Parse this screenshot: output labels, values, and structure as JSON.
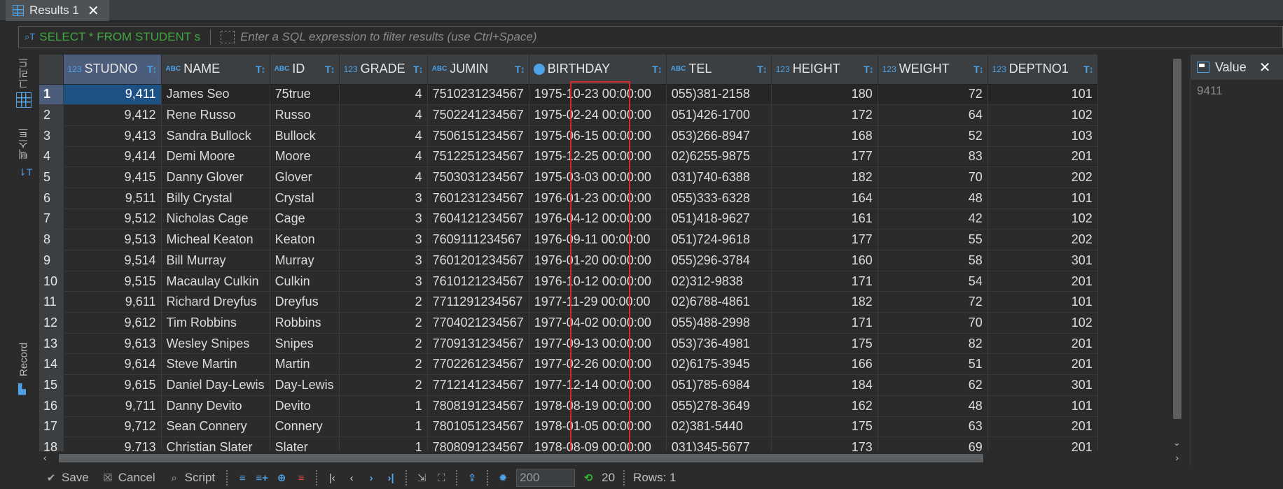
{
  "tab": {
    "label": "Results 1",
    "close": "✕"
  },
  "filter": {
    "sql": "SELECT * FROM STUDENT s",
    "placeholder": "Enter a SQL expression to filter results (use Ctrl+Space)"
  },
  "leftstrip": {
    "grid_label": "그리드",
    "text_label": "텍스트",
    "record_label": "Record"
  },
  "columns": [
    {
      "type": "123",
      "name": "STUDNO"
    },
    {
      "type": "ABC",
      "name": "NAME"
    },
    {
      "type": "ABC",
      "name": "ID"
    },
    {
      "type": "123",
      "name": "GRADE"
    },
    {
      "type": "ABC",
      "name": "JUMIN"
    },
    {
      "type": "date",
      "name": "BIRTHDAY"
    },
    {
      "type": "ABC",
      "name": "TEL"
    },
    {
      "type": "123",
      "name": "HEIGHT"
    },
    {
      "type": "123",
      "name": "WEIGHT"
    },
    {
      "type": "123",
      "name": "DEPTNO1"
    }
  ],
  "rows": [
    [
      "1",
      "9,411",
      "James Seo",
      "75true",
      "4",
      "7510231234567",
      "1975-10-23 00:00:00",
      "055)381-2158",
      "180",
      "72",
      "101"
    ],
    [
      "2",
      "9,412",
      "Rene Russo",
      "Russo",
      "4",
      "7502241234567",
      "1975-02-24 00:00:00",
      "051)426-1700",
      "172",
      "64",
      "102"
    ],
    [
      "3",
      "9,413",
      "Sandra Bullock",
      "Bullock",
      "4",
      "7506151234567",
      "1975-06-15 00:00:00",
      "053)266-8947",
      "168",
      "52",
      "103"
    ],
    [
      "4",
      "9,414",
      "Demi Moore",
      "Moore",
      "4",
      "7512251234567",
      "1975-12-25 00:00:00",
      "02)6255-9875",
      "177",
      "83",
      "201"
    ],
    [
      "5",
      "9,415",
      "Danny Glover",
      "Glover",
      "4",
      "7503031234567",
      "1975-03-03 00:00:00",
      "031)740-6388",
      "182",
      "70",
      "202"
    ],
    [
      "6",
      "9,511",
      "Billy Crystal",
      "Crystal",
      "3",
      "7601231234567",
      "1976-01-23 00:00:00",
      "055)333-6328",
      "164",
      "48",
      "101"
    ],
    [
      "7",
      "9,512",
      "Nicholas Cage",
      "Cage",
      "3",
      "7604121234567",
      "1976-04-12 00:00:00",
      "051)418-9627",
      "161",
      "42",
      "102"
    ],
    [
      "8",
      "9,513",
      "Micheal Keaton",
      "Keaton",
      "3",
      "7609111234567",
      "1976-09-11 00:00:00",
      "051)724-9618",
      "177",
      "55",
      "202"
    ],
    [
      "9",
      "9,514",
      "Bill Murray",
      "Murray",
      "3",
      "7601201234567",
      "1976-01-20 00:00:00",
      "055)296-3784",
      "160",
      "58",
      "301"
    ],
    [
      "10",
      "9,515",
      "Macaulay Culkin",
      "Culkin",
      "3",
      "7610121234567",
      "1976-10-12 00:00:00",
      "02)312-9838",
      "171",
      "54",
      "201"
    ],
    [
      "11",
      "9,611",
      "Richard Dreyfus",
      "Dreyfus",
      "2",
      "7711291234567",
      "1977-11-29 00:00:00",
      "02)6788-4861",
      "182",
      "72",
      "101"
    ],
    [
      "12",
      "9,612",
      "Tim Robbins",
      "Robbins",
      "2",
      "7704021234567",
      "1977-04-02 00:00:00",
      "055)488-2998",
      "171",
      "70",
      "102"
    ],
    [
      "13",
      "9,613",
      "Wesley Snipes",
      "Snipes",
      "2",
      "7709131234567",
      "1977-09-13 00:00:00",
      "053)736-4981",
      "175",
      "82",
      "201"
    ],
    [
      "14",
      "9,614",
      "Steve Martin",
      "Martin",
      "2",
      "7702261234567",
      "1977-02-26 00:00:00",
      "02)6175-3945",
      "166",
      "51",
      "201"
    ],
    [
      "15",
      "9,615",
      "Daniel Day-Lewis",
      "Day-Lewis",
      "2",
      "7712141234567",
      "1977-12-14 00:00:00",
      "051)785-6984",
      "184",
      "62",
      "301"
    ],
    [
      "16",
      "9,711",
      "Danny Devito",
      "Devito",
      "1",
      "7808191234567",
      "1978-08-19 00:00:00",
      "055)278-3649",
      "162",
      "48",
      "101"
    ],
    [
      "17",
      "9,712",
      "Sean Connery",
      "Connery",
      "1",
      "7801051234567",
      "1978-01-05 00:00:00",
      "02)381-5440",
      "175",
      "63",
      "201"
    ],
    [
      "18",
      "9,713",
      "Christian Slater",
      "Slater",
      "1",
      "7808091234567",
      "1978-08-09 00:00:00",
      "031)345-5677",
      "173",
      "69",
      "201"
    ]
  ],
  "value_panel": {
    "title": "Value",
    "value": "9411",
    "close": "✕"
  },
  "bottombar": {
    "save": "Save",
    "cancel": "Cancel",
    "script": "Script",
    "fetch_size": "200",
    "refresh_count": "20",
    "rows_label": "Rows: 1"
  }
}
